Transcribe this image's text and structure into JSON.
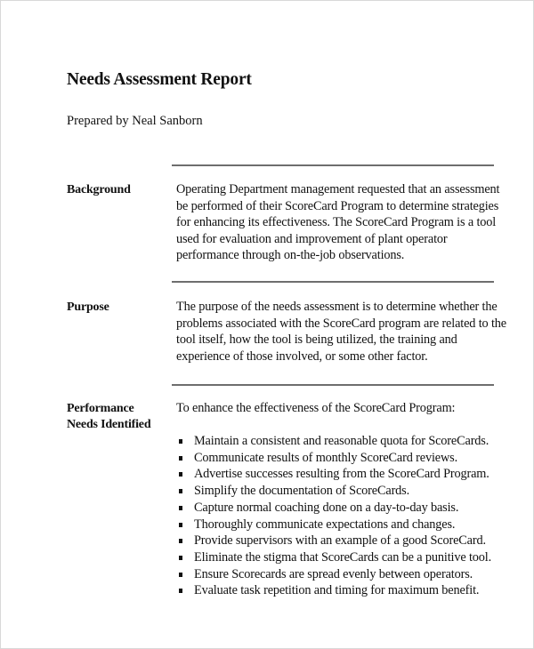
{
  "document": {
    "title": "Needs Assessment Report",
    "prepared_by": "Prepared by Neal Sanborn",
    "sections": [
      {
        "label": "Background",
        "text": "Operating Department management requested that an assessment be performed of their ScoreCard Program to determine strategies for enhancing its effectiveness.  The ScoreCard Program is a tool used for evaluation and improvement of plant operator performance through on-the-job observations."
      },
      {
        "label": "Purpose",
        "text": "The purpose of the needs assessment is to determine whether the problems associated with the ScoreCard program are related to the tool itself, how the tool is being utilized, the training and experience of those involved, or some other factor."
      },
      {
        "label_line1": "Performance",
        "label_line2": "Needs Identified",
        "intro": "To enhance the effectiveness of the ScoreCard Program:",
        "bullets": [
          "Maintain a consistent and reasonable quota for ScoreCards.",
          "Communicate results of monthly ScoreCard reviews.",
          "Advertise successes resulting from the ScoreCard Program.",
          "Simplify the documentation of ScoreCards.",
          "Capture normal coaching done on a day-to-day basis.",
          "Thoroughly communicate expectations and changes.",
          "Provide supervisors with an example of a good ScoreCard.",
          "Eliminate the stigma that ScoreCards can be a punitive tool.",
          "Ensure Scorecards are spread evenly between operators.",
          "Evaluate task repetition and timing for maximum benefit."
        ]
      }
    ]
  }
}
